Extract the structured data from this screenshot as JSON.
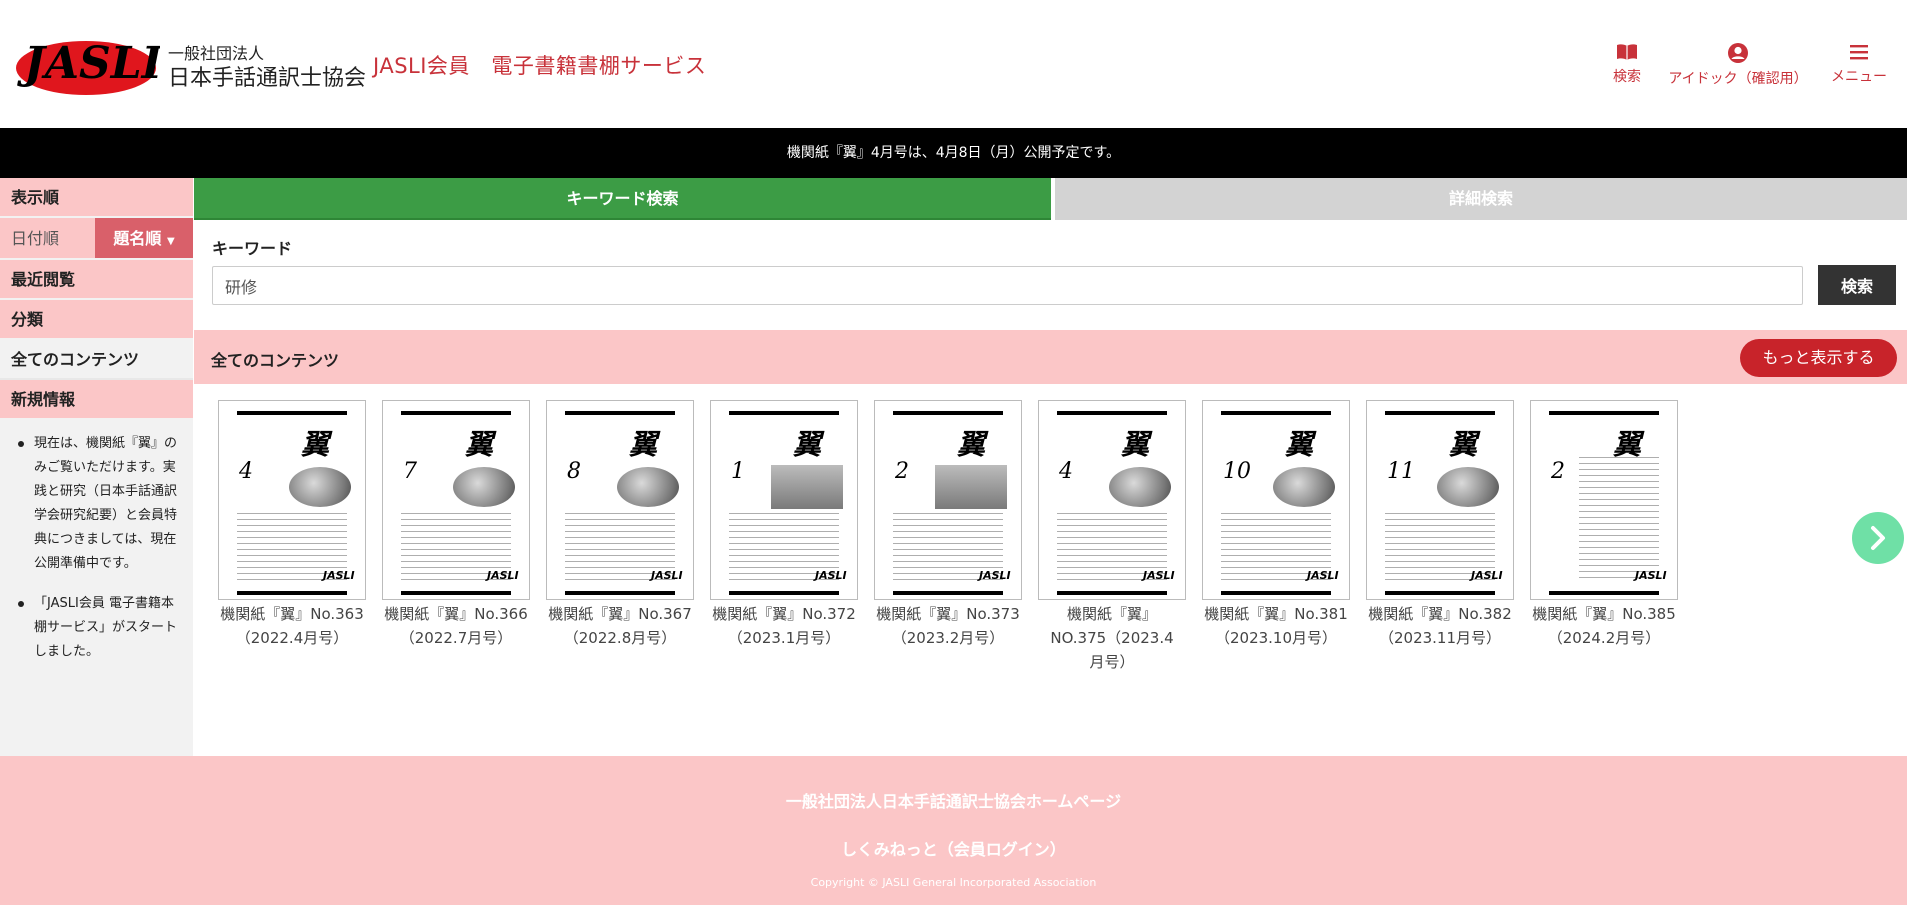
{
  "header": {
    "logo_text": "JASLI",
    "org_small": "一般社団法人",
    "org_large": "日本手話通訳士協会",
    "service_title": "JASLI会員　電子書籍書棚サービス",
    "actions": [
      {
        "label": "検索",
        "icon": "book-icon"
      },
      {
        "label": "アイドック（確認用）",
        "icon": "user-circle-icon"
      },
      {
        "label": "メニュー",
        "icon": "hamburger-menu-icon"
      }
    ],
    "colors": {
      "accent": "#c8323a"
    }
  },
  "announcement": "機関紙『翼』4月号は、4月8日（月）公開予定です。",
  "sidebar": {
    "sort_heading": "表示順",
    "sort_date": "日付順",
    "sort_title": "題名順",
    "recent": "最近閲覧",
    "category": "分類",
    "all_contents": "全てのコンテンツ",
    "news_heading": "新規情報",
    "news": [
      "現在は、機関紙『翼』のみご覧いただけます。実践と研究（日本手話通訳学会研究紀要）と会員特典につきましては、現在公開準備中です。",
      "「JASLI会員 電子書籍本棚サービス」がスタートしました。"
    ]
  },
  "tabs": {
    "keyword": "キーワード検索",
    "detail": "詳細検索"
  },
  "search": {
    "label": "キーワード",
    "value": "研修",
    "button": "検索"
  },
  "contents": {
    "heading": "全てのコンテンツ",
    "more_button": "もっと表示する",
    "items": [
      {
        "title": "機関紙『翼』No.363",
        "issue": "（2022.4月号）",
        "cover_kanji": "翼",
        "cover_num": "4"
      },
      {
        "title": "機関紙『翼』No.366",
        "issue": "（2022.7月号）",
        "cover_kanji": "翼",
        "cover_num": "7"
      },
      {
        "title": "機関紙『翼』No.367",
        "issue": "（2022.8月号）",
        "cover_kanji": "翼",
        "cover_num": "8"
      },
      {
        "title": "機関紙『翼』No.372",
        "issue": "（2023.1月号）",
        "cover_kanji": "翼",
        "cover_num": "1"
      },
      {
        "title": "機関紙『翼』No.373",
        "issue": "（2023.2月号）",
        "cover_kanji": "翼",
        "cover_num": "2"
      },
      {
        "title": "機関紙『翼』",
        "issue": "NO.375（2023.4月号）",
        "cover_kanji": "翼",
        "cover_num": "4"
      },
      {
        "title": "機関紙『翼』No.381",
        "issue": "（2023.10月号）",
        "cover_kanji": "翼",
        "cover_num": "10"
      },
      {
        "title": "機関紙『翼』No.382",
        "issue": "（2023.11月号）",
        "cover_kanji": "翼",
        "cover_num": "11"
      },
      {
        "title": "機関紙『翼』No.385",
        "issue": "（2024.2月号）",
        "cover_kanji": "翼",
        "cover_num": "2"
      }
    ],
    "next_icon": "chevron-right-icon"
  },
  "footer": {
    "homepage_link": "一般社団法人日本手話通訳士協会ホームページ",
    "login_link": "しくみねっと（会員ログイン）",
    "copyright": "Copyright © JASLI General Incorporated Association"
  }
}
